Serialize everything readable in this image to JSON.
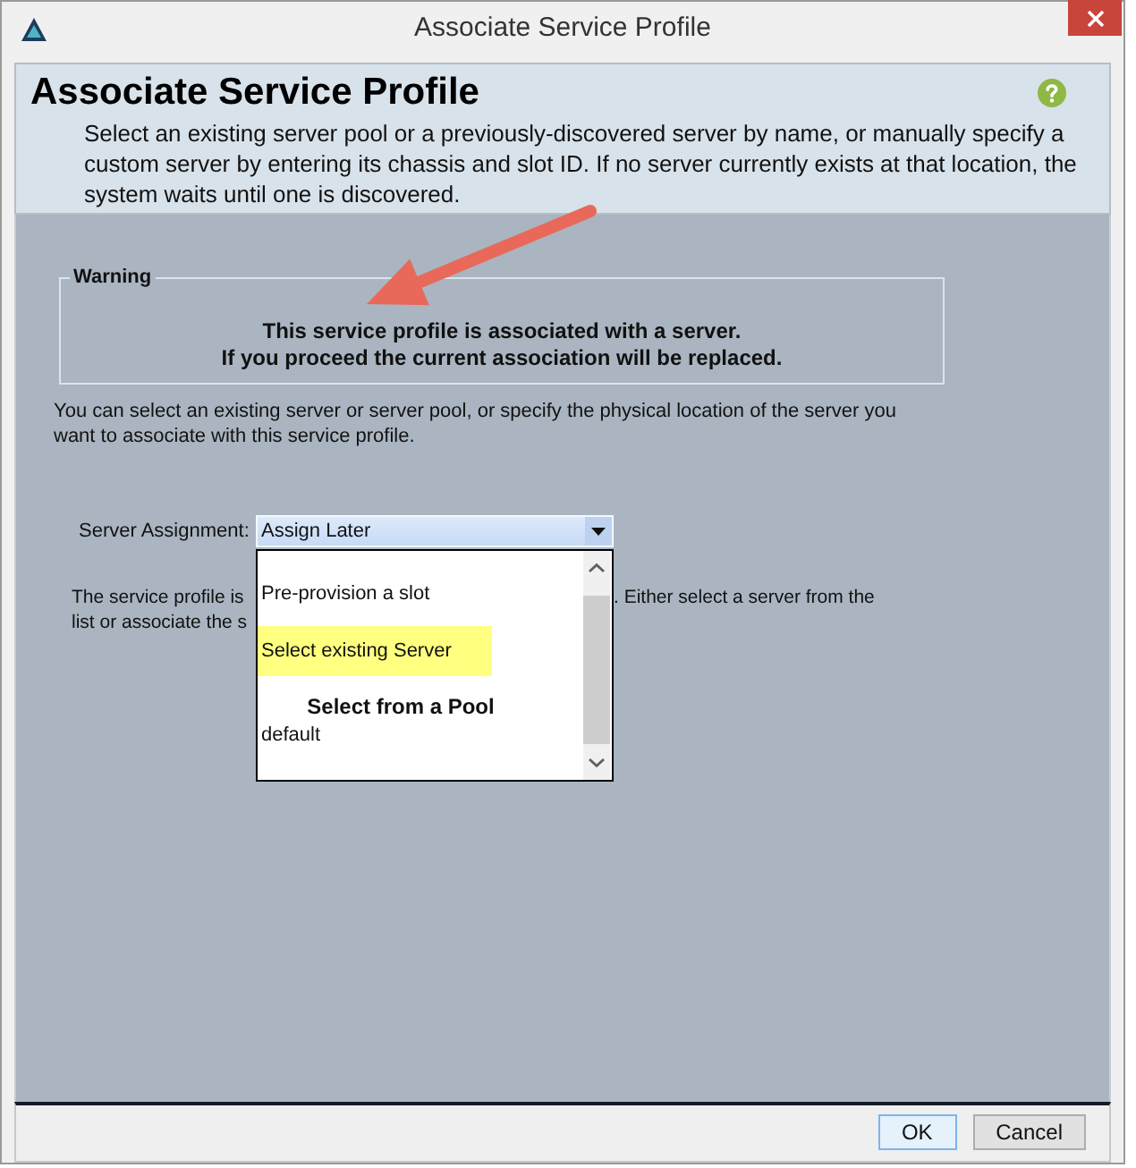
{
  "window": {
    "title": "Associate Service Profile"
  },
  "header": {
    "title": "Associate Service Profile",
    "description": "Select an existing server pool or a previously-discovered server by name, or manually specify a custom server by entering its chassis and slot ID. If no server currently exists at that location, the system waits until one is discovered."
  },
  "warning": {
    "legend": "Warning",
    "lines": [
      "This service profile is associated with a server.",
      "If you proceed the current association will be replaced."
    ]
  },
  "intro": "You can select an existing server or server pool, or specify the physical location of the server you want to associate with this service profile.",
  "server_assignment": {
    "label": "Server Assignment:",
    "value": "Assign Later",
    "expanded": true,
    "options": [
      {
        "kind": "option",
        "label": "Pre-provision a slot",
        "highlighted": false
      },
      {
        "kind": "option",
        "label": "Select existing Server",
        "highlighted": true
      },
      {
        "kind": "heading",
        "label": "Select from a Pool",
        "highlighted": false
      },
      {
        "kind": "pool",
        "label": "default",
        "highlighted": false
      }
    ]
  },
  "note": {
    "lines": [
      {
        "before": "The service profile is",
        "after": ". Either select a server from the"
      },
      {
        "before": "list or associate the s"
      }
    ]
  },
  "buttons": [
    {
      "label": "OK",
      "default": true
    },
    {
      "label": "Cancel",
      "default": false
    }
  ]
}
